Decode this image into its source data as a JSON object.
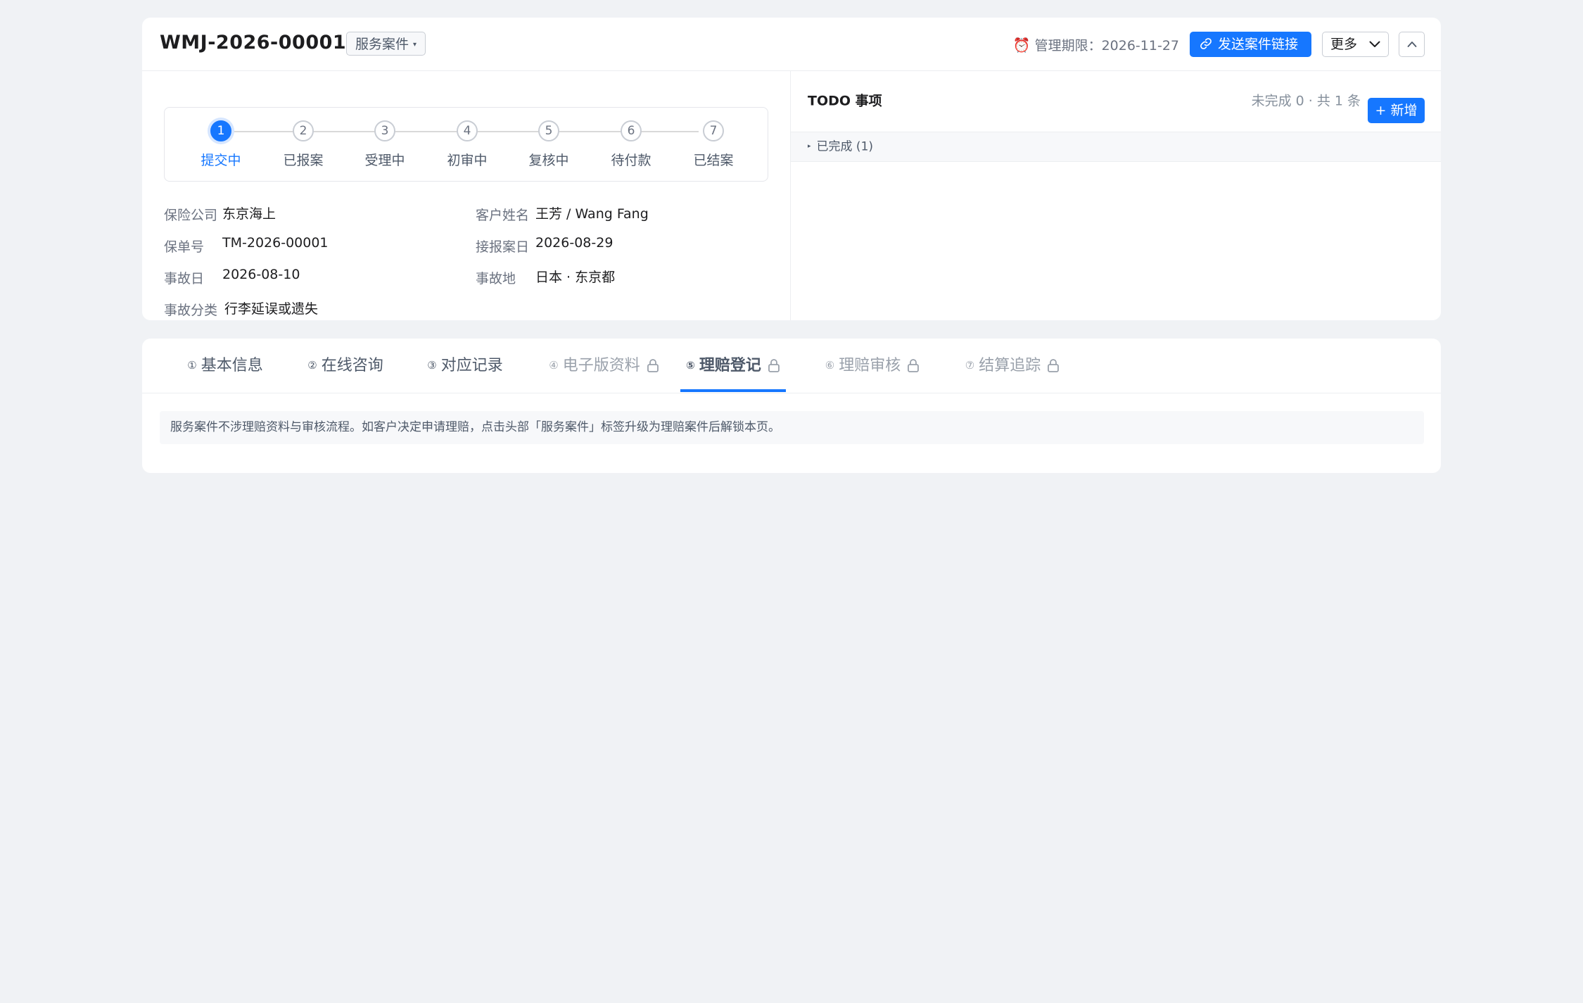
{
  "header": {
    "case_id": "WMJ-2026-00001",
    "case_type": "服务案件",
    "deadline_text": "管理期限：2026-11-27",
    "send_link_label": "发送案件链接",
    "more_label": "更多"
  },
  "steps": [
    {
      "num": "1",
      "label": "提交中",
      "active": true
    },
    {
      "num": "2",
      "label": "已报案"
    },
    {
      "num": "3",
      "label": "受理中"
    },
    {
      "num": "4",
      "label": "初审中"
    },
    {
      "num": "5",
      "label": "复核中"
    },
    {
      "num": "6",
      "label": "待付款"
    },
    {
      "num": "7",
      "label": "已结案"
    }
  ],
  "info": {
    "insurer": {
      "label": "保险公司",
      "value": "东京海上"
    },
    "customer": {
      "label": "客户姓名",
      "value": "王芳 / Wang Fang"
    },
    "policy_no": {
      "label": "保单号",
      "value": "TM-2026-00001"
    },
    "report_date": {
      "label": "接报案日",
      "value": "2026-08-29"
    },
    "accident_date": {
      "label": "事故日",
      "value": "2026-08-10"
    },
    "accident_place": {
      "label": "事故地",
      "value": "日本 · 东京都"
    },
    "accident_category": {
      "label": "事故分类",
      "value": "行李延误或遗失"
    }
  },
  "todo": {
    "title": "TODO 事项",
    "count_text": "未完成 0 · 共 1 条",
    "add_label": "+ 新增",
    "completed_label": "已完成 (1)"
  },
  "tabs": [
    {
      "num": "①",
      "label": "基本信息",
      "locked": false
    },
    {
      "num": "②",
      "label": "在线咨询",
      "locked": false
    },
    {
      "num": "③",
      "label": "对应记录",
      "locked": false
    },
    {
      "num": "④",
      "label": "电子版资料",
      "locked": true
    },
    {
      "num": "⑤",
      "label": "理赔登记",
      "locked": true,
      "active": true
    },
    {
      "num": "⑥",
      "label": "理赔审核",
      "locked": true
    },
    {
      "num": "⑦",
      "label": "结算追踪",
      "locked": true
    }
  ],
  "notice": "服务案件不涉理赔资料与审核流程。如客户决定申请理赔，点击头部「服务案件」标签升级为理赔案件后解锁本页。",
  "colors": {
    "accent": "#1677ff",
    "background": "#f0f2f5",
    "alarm": "#e54b4b"
  }
}
